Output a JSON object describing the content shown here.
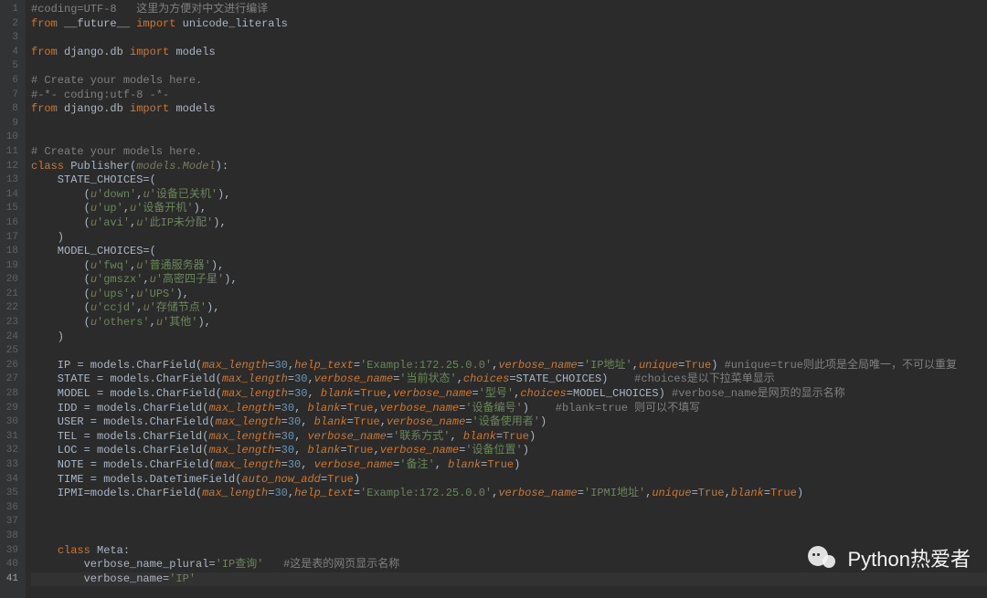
{
  "watermark": "Python热爱者",
  "lineCount": 41,
  "currentLine": 41,
  "code": {
    "l1": {
      "cm": "#coding=UTF-8   这里为方便对中文进行编译"
    },
    "l2": {
      "kw1": "from",
      "mod": "__future__",
      "kw2": "import",
      "name": "unicode_literals"
    },
    "l4": {
      "kw1": "from",
      "mod": "django.db",
      "kw2": "import",
      "name": "models"
    },
    "l6": {
      "cm": "# Create your models here."
    },
    "l7": {
      "cm": "#-*- coding:utf-8 -*-"
    },
    "l8": {
      "kw1": "from",
      "mod": "django.db",
      "kw2": "import",
      "name": "models"
    },
    "l11": {
      "cm": "# Create your models here."
    },
    "l12": {
      "kw": "class",
      "name": "Publisher",
      "base": "models.Model"
    },
    "l13": {
      "var": "STATE_CHOICES"
    },
    "l14": {
      "k": "down",
      "v": "设备已关机"
    },
    "l15": {
      "k": "up",
      "v": "设备开机"
    },
    "l16": {
      "k": "avi",
      "v": "此IP未分配"
    },
    "l18": {
      "var": "MODEL_CHOICES"
    },
    "l19": {
      "k": "fwq",
      "v": "普通服务器"
    },
    "l20": {
      "k": "gmszx",
      "v": "高密四子星"
    },
    "l21": {
      "k": "ups",
      "v": "UPS"
    },
    "l22": {
      "k": "ccjd",
      "v": "存储节点"
    },
    "l23": {
      "k": "others",
      "v": "其他"
    },
    "l26": {
      "var": "IP",
      "call": "models.CharField",
      "args": "max_length=30,help_text='Example:172.25.0.0',verbose_name='IP地址',unique=True",
      "cm": "#unique=true则此项是全局唯一，不可以重复"
    },
    "l27": {
      "var": "STATE",
      "call": "models.CharField",
      "args": "max_length=30,verbose_name='当前状态',choices=STATE_CHOICES",
      "cm": "#choices是以下拉菜单显示"
    },
    "l28": {
      "var": "MODEL",
      "call": "models.CharField",
      "args": "max_length=30, blank=True,verbose_name='型号',choices=MODEL_CHOICES",
      "cm": "#verbose_name是网页的显示名称"
    },
    "l29": {
      "var": "IDD",
      "call": "models.CharField",
      "args": "max_length=30, blank=True,verbose_name='设备编号'",
      "cm": "#blank=true 则可以不填写"
    },
    "l30": {
      "var": "USER",
      "call": "models.CharField",
      "args": "max_length=30, blank=True,verbose_name='设备使用者'"
    },
    "l31": {
      "var": "TEL",
      "call": "models.CharField",
      "args": "max_length=30, verbose_name='联系方式', blank=True"
    },
    "l32": {
      "var": "LOC",
      "call": "models.CharField",
      "args": "max_length=30, blank=True,verbose_name='设备位置'"
    },
    "l33": {
      "var": "NOTE",
      "call": "models.CharField",
      "args": "max_length=30, verbose_name='备注', blank=True"
    },
    "l34": {
      "var": "TIME",
      "call": "models.DateTimeField",
      "args": "auto_now_add=True"
    },
    "l35": {
      "var": "IPMI",
      "call": "models.CharField",
      "args": "max_length=30,help_text='Example:172.25.0.0',verbose_name='IPMI地址',unique=True,blank=True"
    },
    "l39": {
      "kw": "class",
      "name": "Meta"
    },
    "l40": {
      "var": "verbose_name_plural",
      "val": "IP查询",
      "cm": "#这是表的网页显示名称"
    },
    "l41": {
      "var": "verbose_name",
      "val": "IP"
    }
  }
}
